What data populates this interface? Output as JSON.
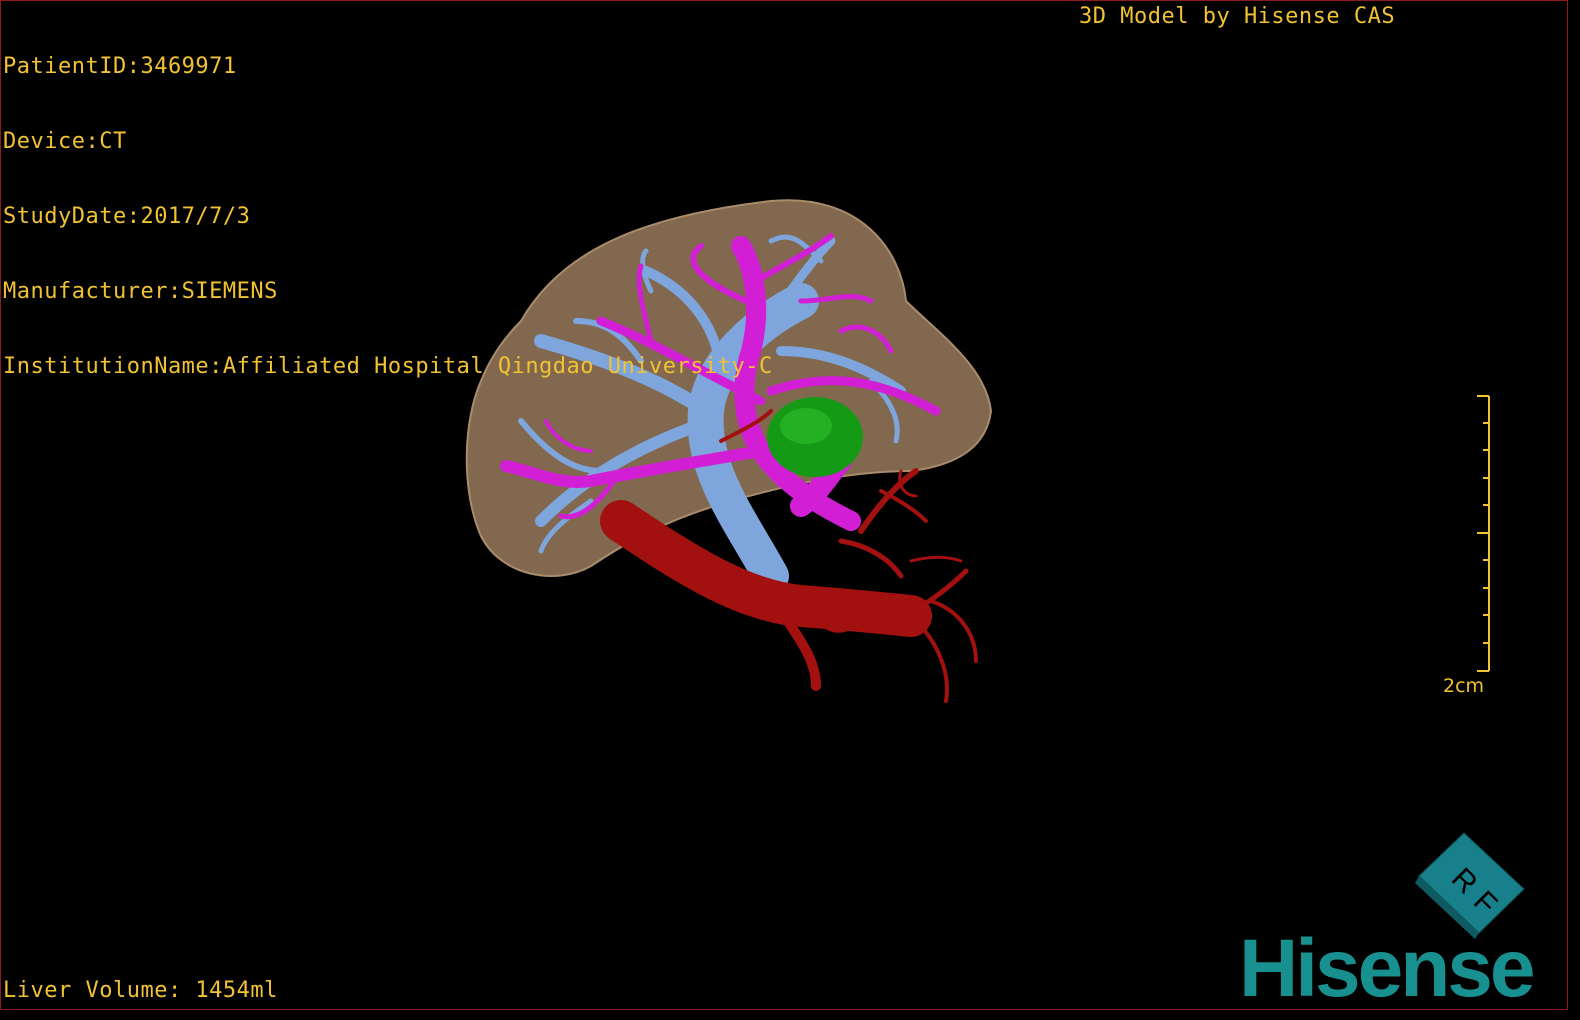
{
  "header": {
    "patient_id": "PatientID:3469971",
    "device": "Device:CT",
    "study_date": "StudyDate:2017/7/3",
    "manufacturer": "Manufacturer:SIEMENS",
    "institution": "InstitutionName:Affiliated Hospital Qingdao University-C",
    "credit": "3D Model by Hisense CAS"
  },
  "footer": {
    "liver_volume": "Liver Volume: 1454ml"
  },
  "scale": {
    "label": "2cm"
  },
  "orientation_cube": {
    "face_label_1": "R",
    "face_label_2": "F"
  },
  "logo": {
    "text": "Hisense"
  },
  "colors": {
    "overlay_text": "#f1c232",
    "liver": "#8c7155",
    "hepatic_vein": "#7ea6dd",
    "portal_vein": "#d21fd6",
    "artery": "#a31010",
    "tumor": "#159a15",
    "brand": "#17908f"
  },
  "scene": {
    "structures": [
      "liver",
      "hepatic-veins",
      "portal-veins",
      "arteries",
      "tumor"
    ]
  }
}
